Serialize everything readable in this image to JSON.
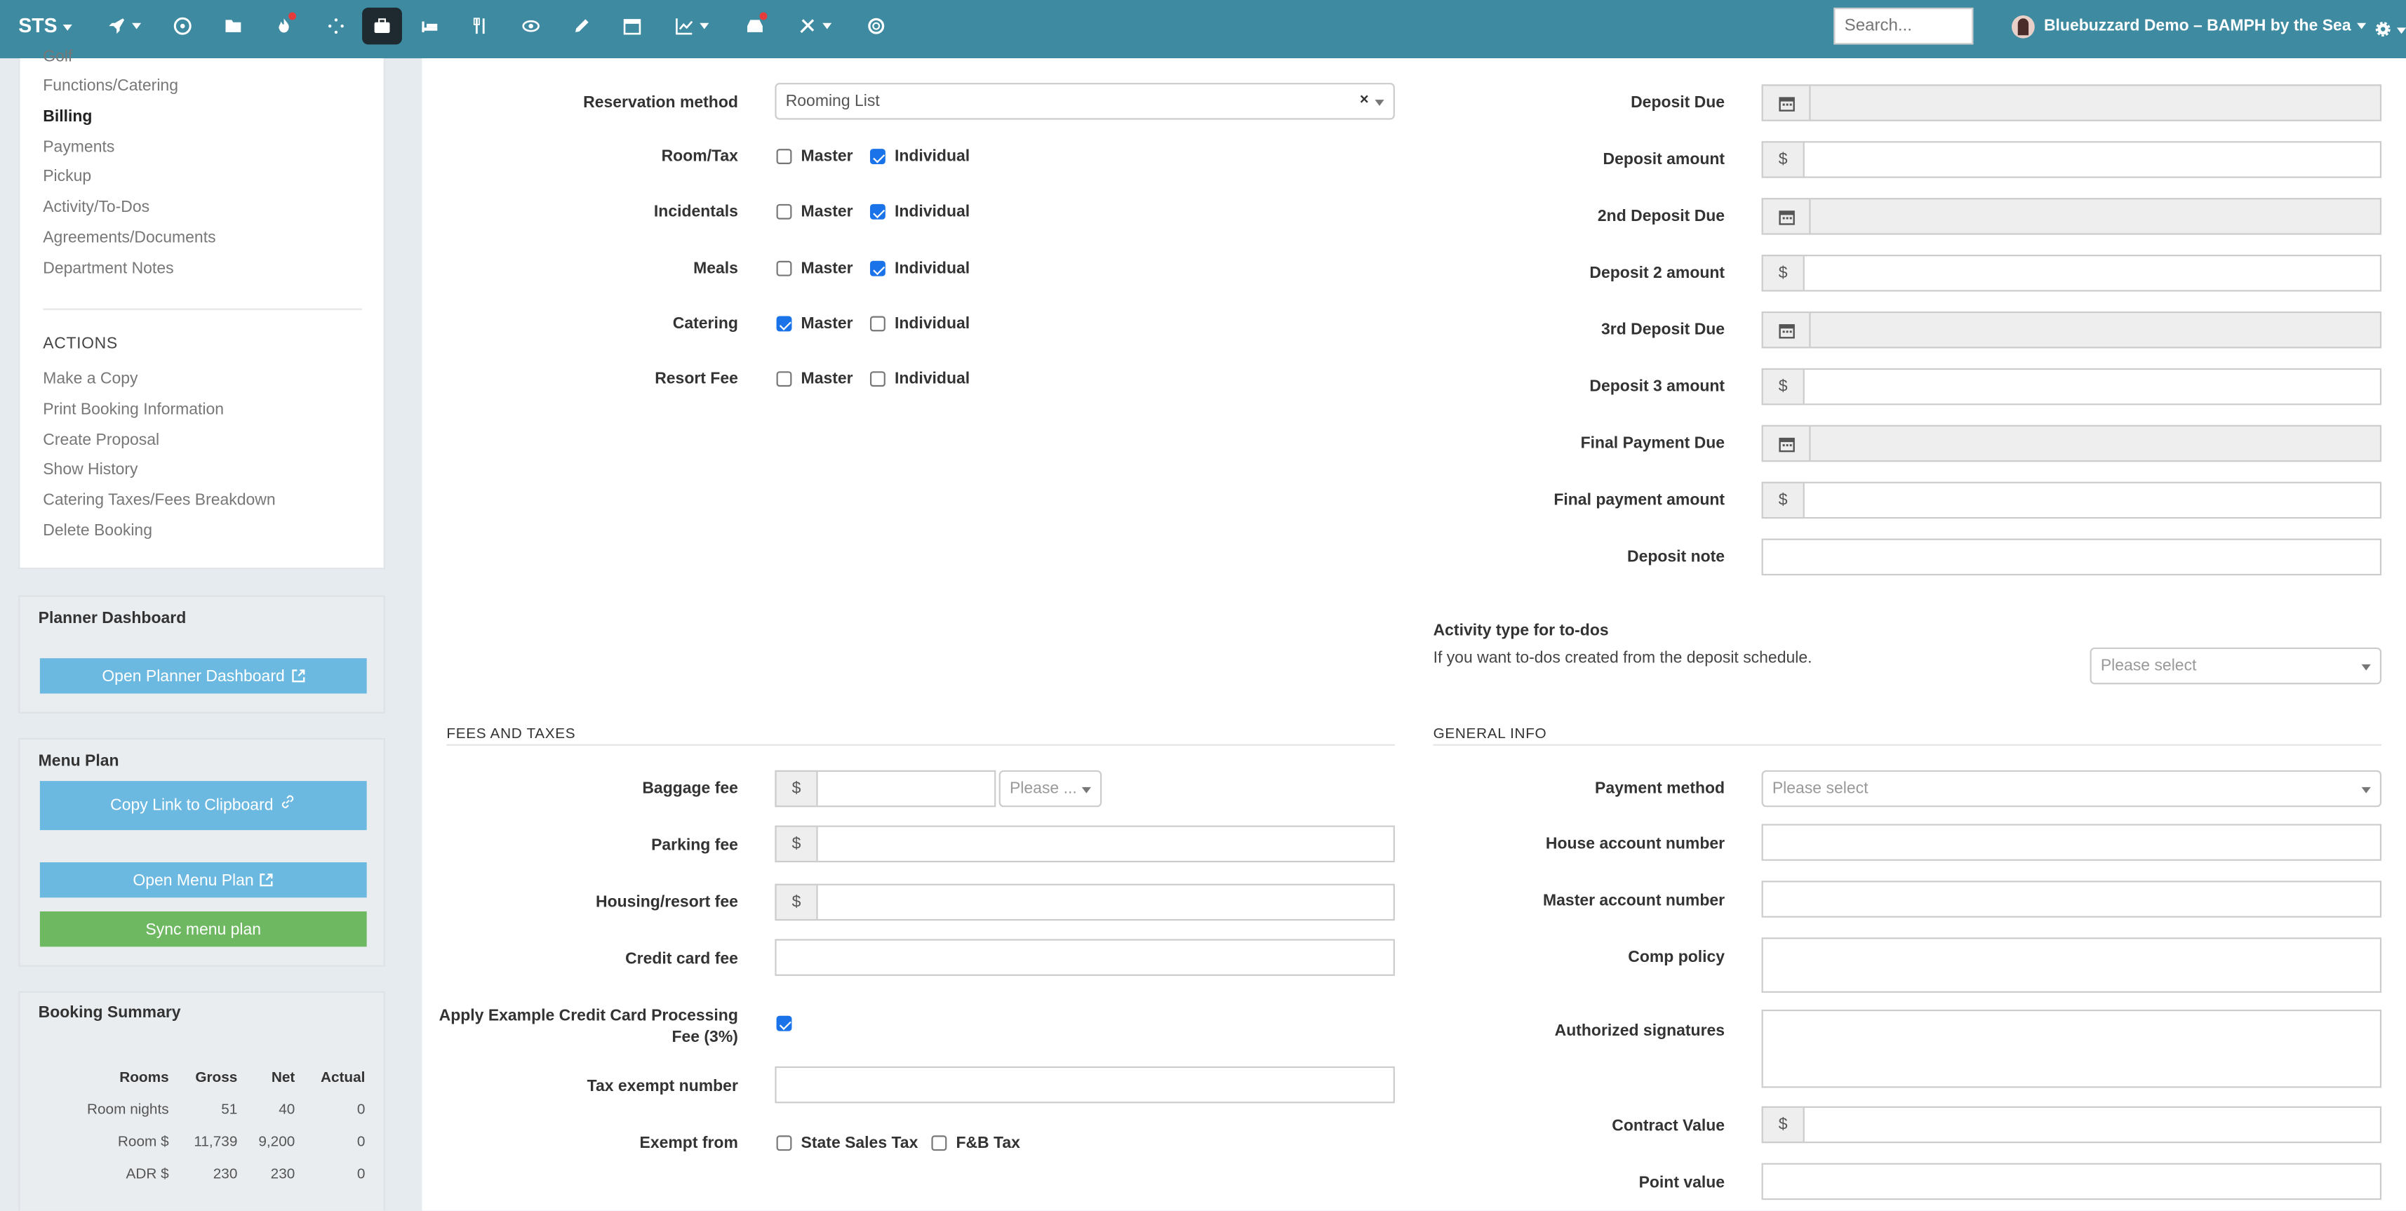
{
  "topbar": {
    "brand": "STS",
    "search_placeholder": "Search...",
    "user_name": "Bluebuzzard Demo – BAMPH by the Sea"
  },
  "sidebar": {
    "partial_link": "Golf",
    "links": [
      "Functions/Catering",
      "Billing",
      "Payments",
      "Pickup",
      "Activity/To-Dos",
      "Agreements/Documents",
      "Department Notes"
    ],
    "actions_heading": "ACTIONS",
    "actions": [
      "Make a Copy",
      "Print Booking Information",
      "Create Proposal",
      "Show History",
      "Catering Taxes/Fees Breakdown",
      "Delete Booking"
    ]
  },
  "planner": {
    "title": "Planner Dashboard",
    "button": "Open Planner Dashboard"
  },
  "menu_plan": {
    "title": "Menu Plan",
    "copy_button": "Copy Link to Clipboard",
    "open_button": "Open Menu Plan",
    "sync_button": "Sync menu plan"
  },
  "booking_summary": {
    "title": "Booking Summary",
    "headers": [
      "Rooms",
      "Gross",
      "Net",
      "Actual"
    ],
    "rows": [
      [
        "Room nights",
        "51",
        "40",
        "0"
      ],
      [
        "Room $",
        "11,739",
        "9,200",
        "0"
      ],
      [
        "ADR $",
        "230",
        "230",
        "0"
      ]
    ]
  },
  "billing": {
    "reservation_method_label": "Reservation method",
    "reservation_method_value": "Rooming List",
    "master_label": "Master",
    "individual_label": "Individual",
    "rows": [
      {
        "label": "Room/Tax",
        "master": false,
        "individual": true
      },
      {
        "label": "Incidentals",
        "master": false,
        "individual": true
      },
      {
        "label": "Meals",
        "master": false,
        "individual": true
      },
      {
        "label": "Catering",
        "master": true,
        "individual": false
      },
      {
        "label": "Resort Fee",
        "master": false,
        "individual": false
      }
    ]
  },
  "deposits": {
    "currency": "$",
    "labels": [
      "Deposit Due",
      "Deposit amount",
      "2nd Deposit Due",
      "Deposit 2 amount",
      "3rd Deposit Due",
      "Deposit 3 amount",
      "Final Payment Due",
      "Final payment amount",
      "Deposit note"
    ],
    "activity_title": "Activity type for to-dos",
    "activity_help": "If you want to-dos created from the deposit schedule.",
    "activity_placeholder": "Please select"
  },
  "fees": {
    "section_title": "FEES AND TAXES",
    "baggage_label": "Baggage fee",
    "baggage_unit_placeholder": "Please ...",
    "parking_label": "Parking fee",
    "housing_label": "Housing/resort fee",
    "credit_card_label": "Credit card fee",
    "apply_cc_label_1": "Apply Example Credit Card Processing",
    "apply_cc_label_2": "Fee (3%)",
    "apply_cc_checked": true,
    "tax_exempt_label": "Tax exempt number",
    "exempt_from_label": "Exempt from",
    "state_sales_tax": "State Sales Tax",
    "fb_tax": "F&B Tax"
  },
  "general": {
    "section_title": "GENERAL INFO",
    "payment_method_label": "Payment method",
    "payment_method_placeholder": "Please select",
    "house_account_label": "House account number",
    "master_account_label": "Master account number",
    "comp_policy_label": "Comp policy",
    "authorized_label": "Authorized signatures",
    "contract_value_label": "Contract Value",
    "point_value_label": "Point value"
  },
  "colors": {
    "topbar": "#3d8aa1",
    "button_blue": "#6bb8e0",
    "button_green": "#6db860",
    "checkbox_checked": "#1a73e8"
  }
}
